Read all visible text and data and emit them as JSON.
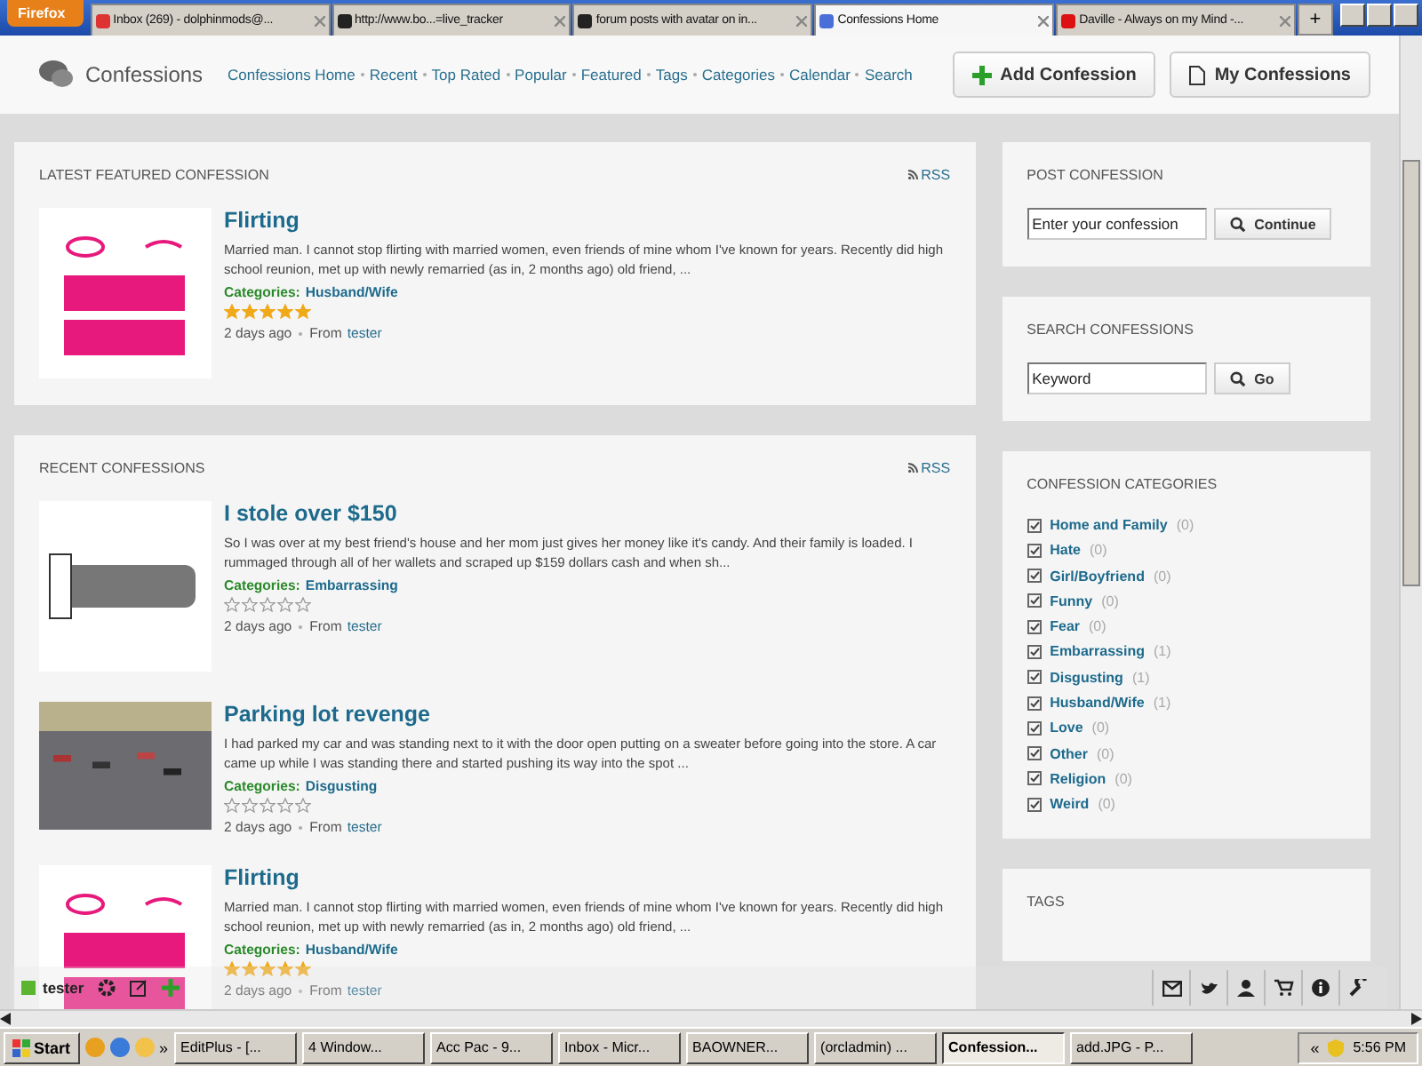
{
  "browser": {
    "menu_button": "Firefox",
    "tabs": [
      {
        "title": "Inbox (269) - dolphinmods@...",
        "selected": false,
        "kind": "mail"
      },
      {
        "title": "http://www.bo...=live_tracker",
        "selected": false,
        "kind": "site"
      },
      {
        "title": "forum posts with avatar on in...",
        "selected": false,
        "kind": "site"
      },
      {
        "title": "Confessions Home",
        "selected": true,
        "kind": "grid"
      },
      {
        "title": "Daville - Always on my Mind -...",
        "selected": false,
        "kind": "video"
      }
    ],
    "new_tab": "+"
  },
  "header": {
    "logo": "Confessions",
    "nav": [
      "Confessions Home",
      "Recent",
      "Top Rated",
      "Popular",
      "Featured",
      "Tags",
      "Categories",
      "Calendar",
      "Search"
    ],
    "buttons": [
      {
        "label": "Add Confession",
        "kind": "add"
      },
      {
        "label": "My Confessions",
        "kind": "doc"
      }
    ]
  },
  "featured": {
    "heading": "LATEST FEATURED CONFESSION",
    "rss": "RSS",
    "items": [
      {
        "title": "Flirting",
        "kind": "flirt",
        "text": "Married man. I cannot stop flirting with married women, even friends of mine whom I've known for years. Recently did high school reunion, met up with newly remarried (as in, 2 months ago) old friend, ...",
        "categories_label": "Categories:",
        "category": "Husband/Wife",
        "stars": 5,
        "time": "2 days ago",
        "from_label": "From",
        "author": "tester"
      }
    ]
  },
  "recent": {
    "heading": "RECENT CONFESSIONS",
    "rss": "RSS",
    "items": [
      {
        "title": "I stole over $150",
        "kind": "logo",
        "text": "So I was over at my best friend's house and her mom just gives her money like it's candy. And their family is loaded. I rummaged through all of her wallets and scraped up $159 dollars cash and when sh...",
        "categories_label": "Categories:",
        "category": "Embarrassing",
        "stars": 0,
        "time": "2 days ago",
        "from_label": "From",
        "author": "tester"
      },
      {
        "title": "Parking lot revenge",
        "kind": "photo",
        "text": "I had parked my car and was standing next to it with the door open putting on a sweater before going into the store. A car came up while I was standing there and started pushing its way into the spot ...",
        "categories_label": "Categories:",
        "category": "Disgusting",
        "stars": 0,
        "time": "2 days ago",
        "from_label": "From",
        "author": "tester"
      },
      {
        "title": "Flirting",
        "kind": "flirt",
        "text": "Married man. I cannot stop flirting with married women, even friends of mine whom I've known for years. Recently did high school reunion, met up with newly remarried (as in, 2 months ago) old friend, ...",
        "categories_label": "Categories:",
        "category": "Husband/Wife",
        "stars": 5,
        "time": "2 days ago",
        "from_label": "From",
        "author": "tester"
      }
    ]
  },
  "post": {
    "heading": "POST CONFESSION",
    "placeholder": "Enter your confession",
    "button": "Continue"
  },
  "search": {
    "heading": "SEARCH CONFESSIONS",
    "placeholder": "Keyword",
    "button": "Go"
  },
  "categories": {
    "heading": "CONFESSION CATEGORIES",
    "items": [
      {
        "name": "Home and Family",
        "count": "(0)"
      },
      {
        "name": "Hate",
        "count": "(0)"
      },
      {
        "name": "Girl/Boyfriend",
        "count": "(0)"
      },
      {
        "name": "Funny",
        "count": "(0)"
      },
      {
        "name": "Fear",
        "count": "(0)"
      },
      {
        "name": "Embarrassing",
        "count": "(1)"
      },
      {
        "name": "Disgusting",
        "count": "(1)"
      },
      {
        "name": "Husband/Wife",
        "count": "(1)"
      },
      {
        "name": "Love",
        "count": "(0)"
      },
      {
        "name": "Other",
        "count": "(0)"
      },
      {
        "name": "Religion",
        "count": "(0)"
      },
      {
        "name": "Weird",
        "count": "(0)"
      }
    ]
  },
  "tags": {
    "heading": "TAGS"
  },
  "toolbar": {
    "user": "tester"
  },
  "taskbar": {
    "start": "Start",
    "chevron_left": "»",
    "items": [
      {
        "label": "EditPlus - [...",
        "selected": false
      },
      {
        "label": "4 Window...",
        "selected": false
      },
      {
        "label": "Acc Pac - 9...",
        "selected": false
      },
      {
        "label": "Inbox - Micr...",
        "selected": false
      },
      {
        "label": "BAOWNER...",
        "selected": false
      },
      {
        "label": "(orcladmin) ...",
        "selected": false
      },
      {
        "label": "Confession...",
        "selected": true
      },
      {
        "label": "add.JPG - P...",
        "selected": false
      }
    ],
    "chevron_right": "«",
    "clock": "5:56 PM"
  }
}
